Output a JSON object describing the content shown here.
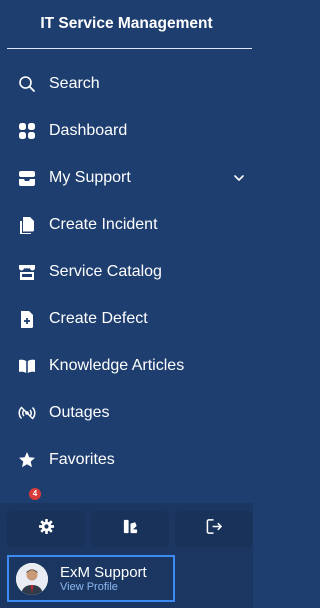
{
  "header": {
    "title": "IT Service Management"
  },
  "nav": {
    "search": "Search",
    "dashboard": "Dashboard",
    "my_support": "My Support",
    "create_incident": "Create Incident",
    "service_catalog": "Service Catalog",
    "create_defect": "Create Defect",
    "knowledge_articles": "Knowledge Articles",
    "outages": "Outages",
    "favorites": "Favorites"
  },
  "notification_badge": "4",
  "actions": {
    "settings_icon": "gear-icon",
    "theme_icon": "theme-icon",
    "logout_icon": "logout-icon"
  },
  "profile": {
    "name": "ExM Support",
    "link": "View Profile"
  },
  "colors": {
    "sidebar_bg": "#1e3e70",
    "footer_bg": "#1b3761",
    "button_bg": "#18325a",
    "profile_border": "#3d8bf2",
    "link": "#8cb8f0",
    "badge": "#d93a3a"
  }
}
